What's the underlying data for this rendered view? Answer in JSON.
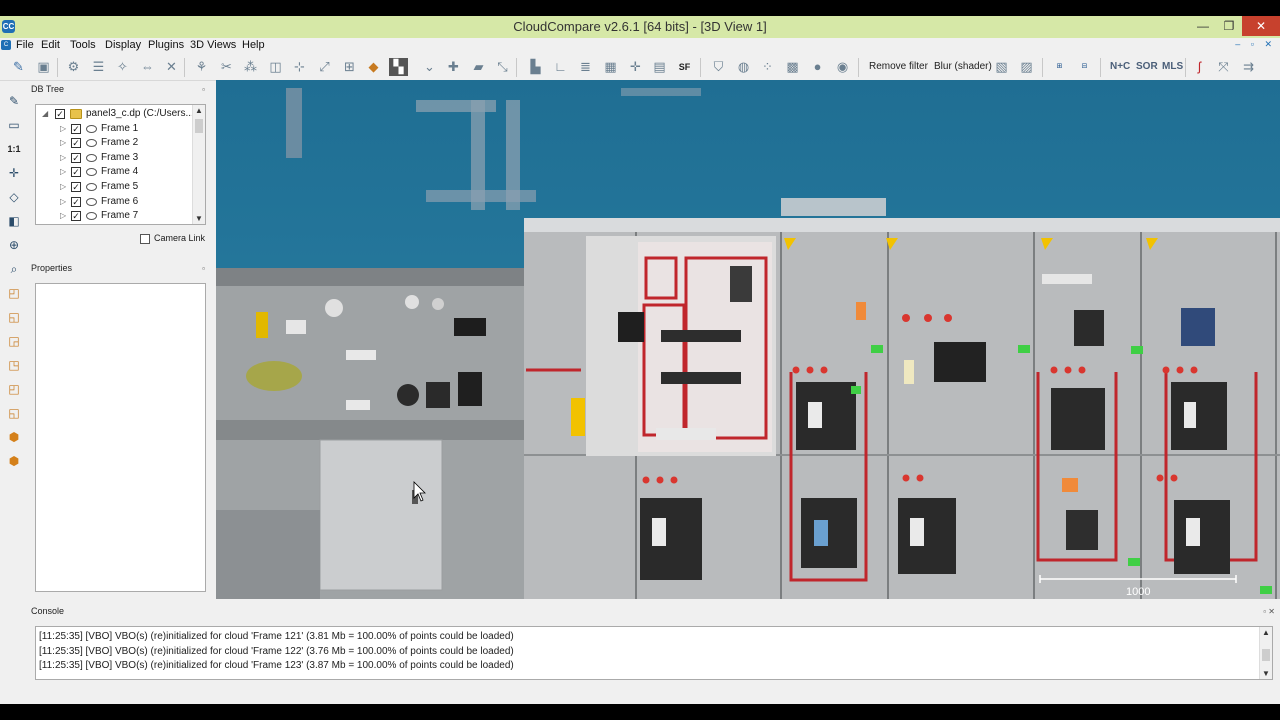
{
  "window": {
    "title": "CloudCompare v2.6.1 [64 bits] - [3D View 1]",
    "minimize": "—",
    "maximize": "❐",
    "close": "✕"
  },
  "menu": [
    "File",
    "Edit",
    "Tools",
    "Display",
    "Plugins",
    "3D Views",
    "Help"
  ],
  "mdi_controls": "– ▫ ✕",
  "toolbar": {
    "remove_filter": "Remove filter",
    "blur_shader": "Blur (shader)",
    "n_c": "N+C",
    "sor": "SOR",
    "mls": "MLS"
  },
  "left_toolbar": {
    "one_to_one": "1:1"
  },
  "dbtree": {
    "title": "DB Tree",
    "root": "panel3_c.dp (C:/Users...",
    "frames": [
      "Frame 1",
      "Frame 2",
      "Frame 3",
      "Frame 4",
      "Frame 5",
      "Frame 6",
      "Frame 7"
    ],
    "camera_link": "Camera Link"
  },
  "properties": {
    "title": "Properties"
  },
  "view": {
    "scale_label": "1000"
  },
  "console": {
    "title": "Console",
    "lines": [
      "[11:25:35] [VBO] VBO(s) (re)initialized for cloud 'Frame 121' (3.81 Mb = 100.00% of points could be loaded)",
      "[11:25:35] [VBO] VBO(s) (re)initialized for cloud 'Frame 122' (3.76 Mb = 100.00% of points could be loaded)",
      "[11:25:35] [VBO] VBO(s) (re)initialized for cloud 'Frame 123' (3.87 Mb = 100.00% of points could be loaded)"
    ]
  },
  "colors": {
    "titlebar": "#d6e8a7",
    "close_button": "#c7412d",
    "view_background": "#2a7a9b",
    "panel_gray": "#b9bbbd",
    "wire_red": "#c0262c",
    "warning_yellow": "#f2c200"
  }
}
